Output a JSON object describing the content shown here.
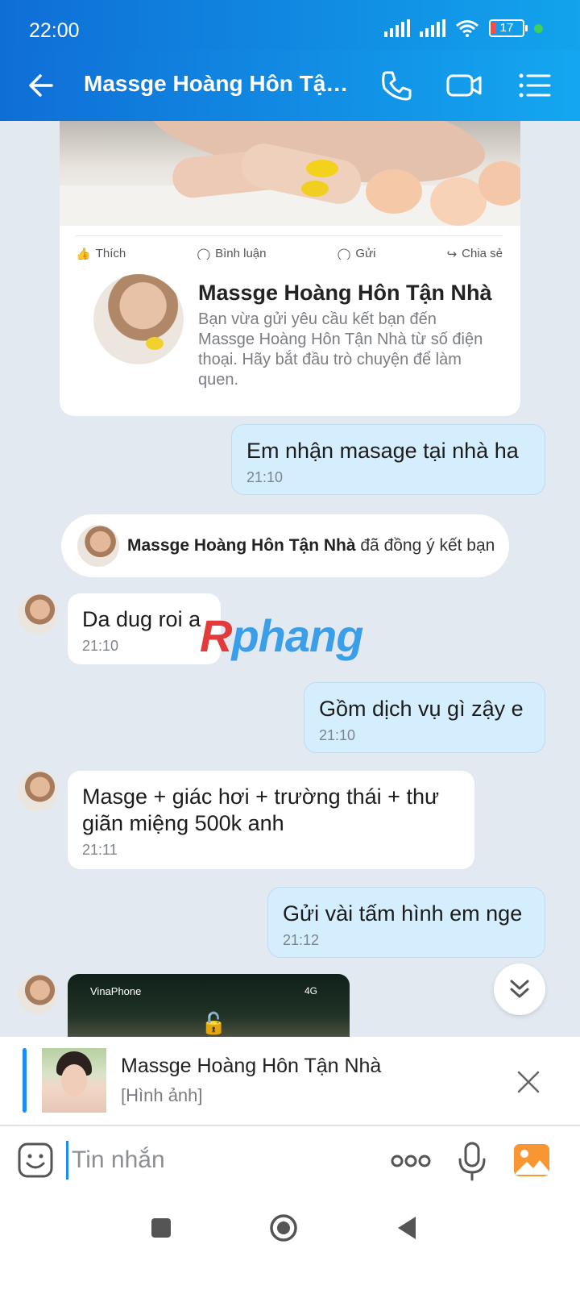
{
  "status_bar": {
    "time": "22:00",
    "battery": "17"
  },
  "header": {
    "title": "Massge Hoàng Hôn Tận Nhà"
  },
  "profile_card": {
    "actions": [
      "Thích",
      "Bình luận",
      "Gửi",
      "Chia sẻ"
    ],
    "name": "Massge Hoàng Hôn Tận Nhà",
    "description": "Bạn vừa gửi yêu cầu kết bạn đến Massge Hoàng Hôn Tận Nhà từ số điện thoại. Hãy bắt đầu trò chuyện để làm quen."
  },
  "messages": [
    {
      "from": "me",
      "text": "Em nhận masage tại nhà ha",
      "time": "21:10"
    },
    {
      "from": "them",
      "text": "Da dug roi a",
      "time": "21:10"
    },
    {
      "from": "me",
      "text": "Gồm dịch vụ gì zậy e",
      "time": "21:10"
    },
    {
      "from": "them",
      "text": "Masge + giác hơi + trường thái + thư giãn miệng 500k anh",
      "time": "21:11"
    },
    {
      "from": "me",
      "text": "Gửi vài tấm hình em nge",
      "time": "21:12"
    }
  ],
  "system_message": {
    "name": "Massge Hoàng Hôn Tận Nhà",
    "text": "đã đồng ý kết bạn"
  },
  "image_message": {
    "carrier": "VinaPhone",
    "network": "4G"
  },
  "watermark": {
    "first_letter": "R",
    "rest": "phang"
  },
  "reply_preview": {
    "name": "Massge Hoàng Hôn Tận Nhà",
    "subtitle": "[Hình ảnh]"
  },
  "input": {
    "placeholder": "Tin nhắn"
  },
  "colors": {
    "header": "#0f6ed6",
    "my_bubble": "#d5eefd",
    "accent": "#1a8ef0",
    "background": "#e2e9f1"
  }
}
